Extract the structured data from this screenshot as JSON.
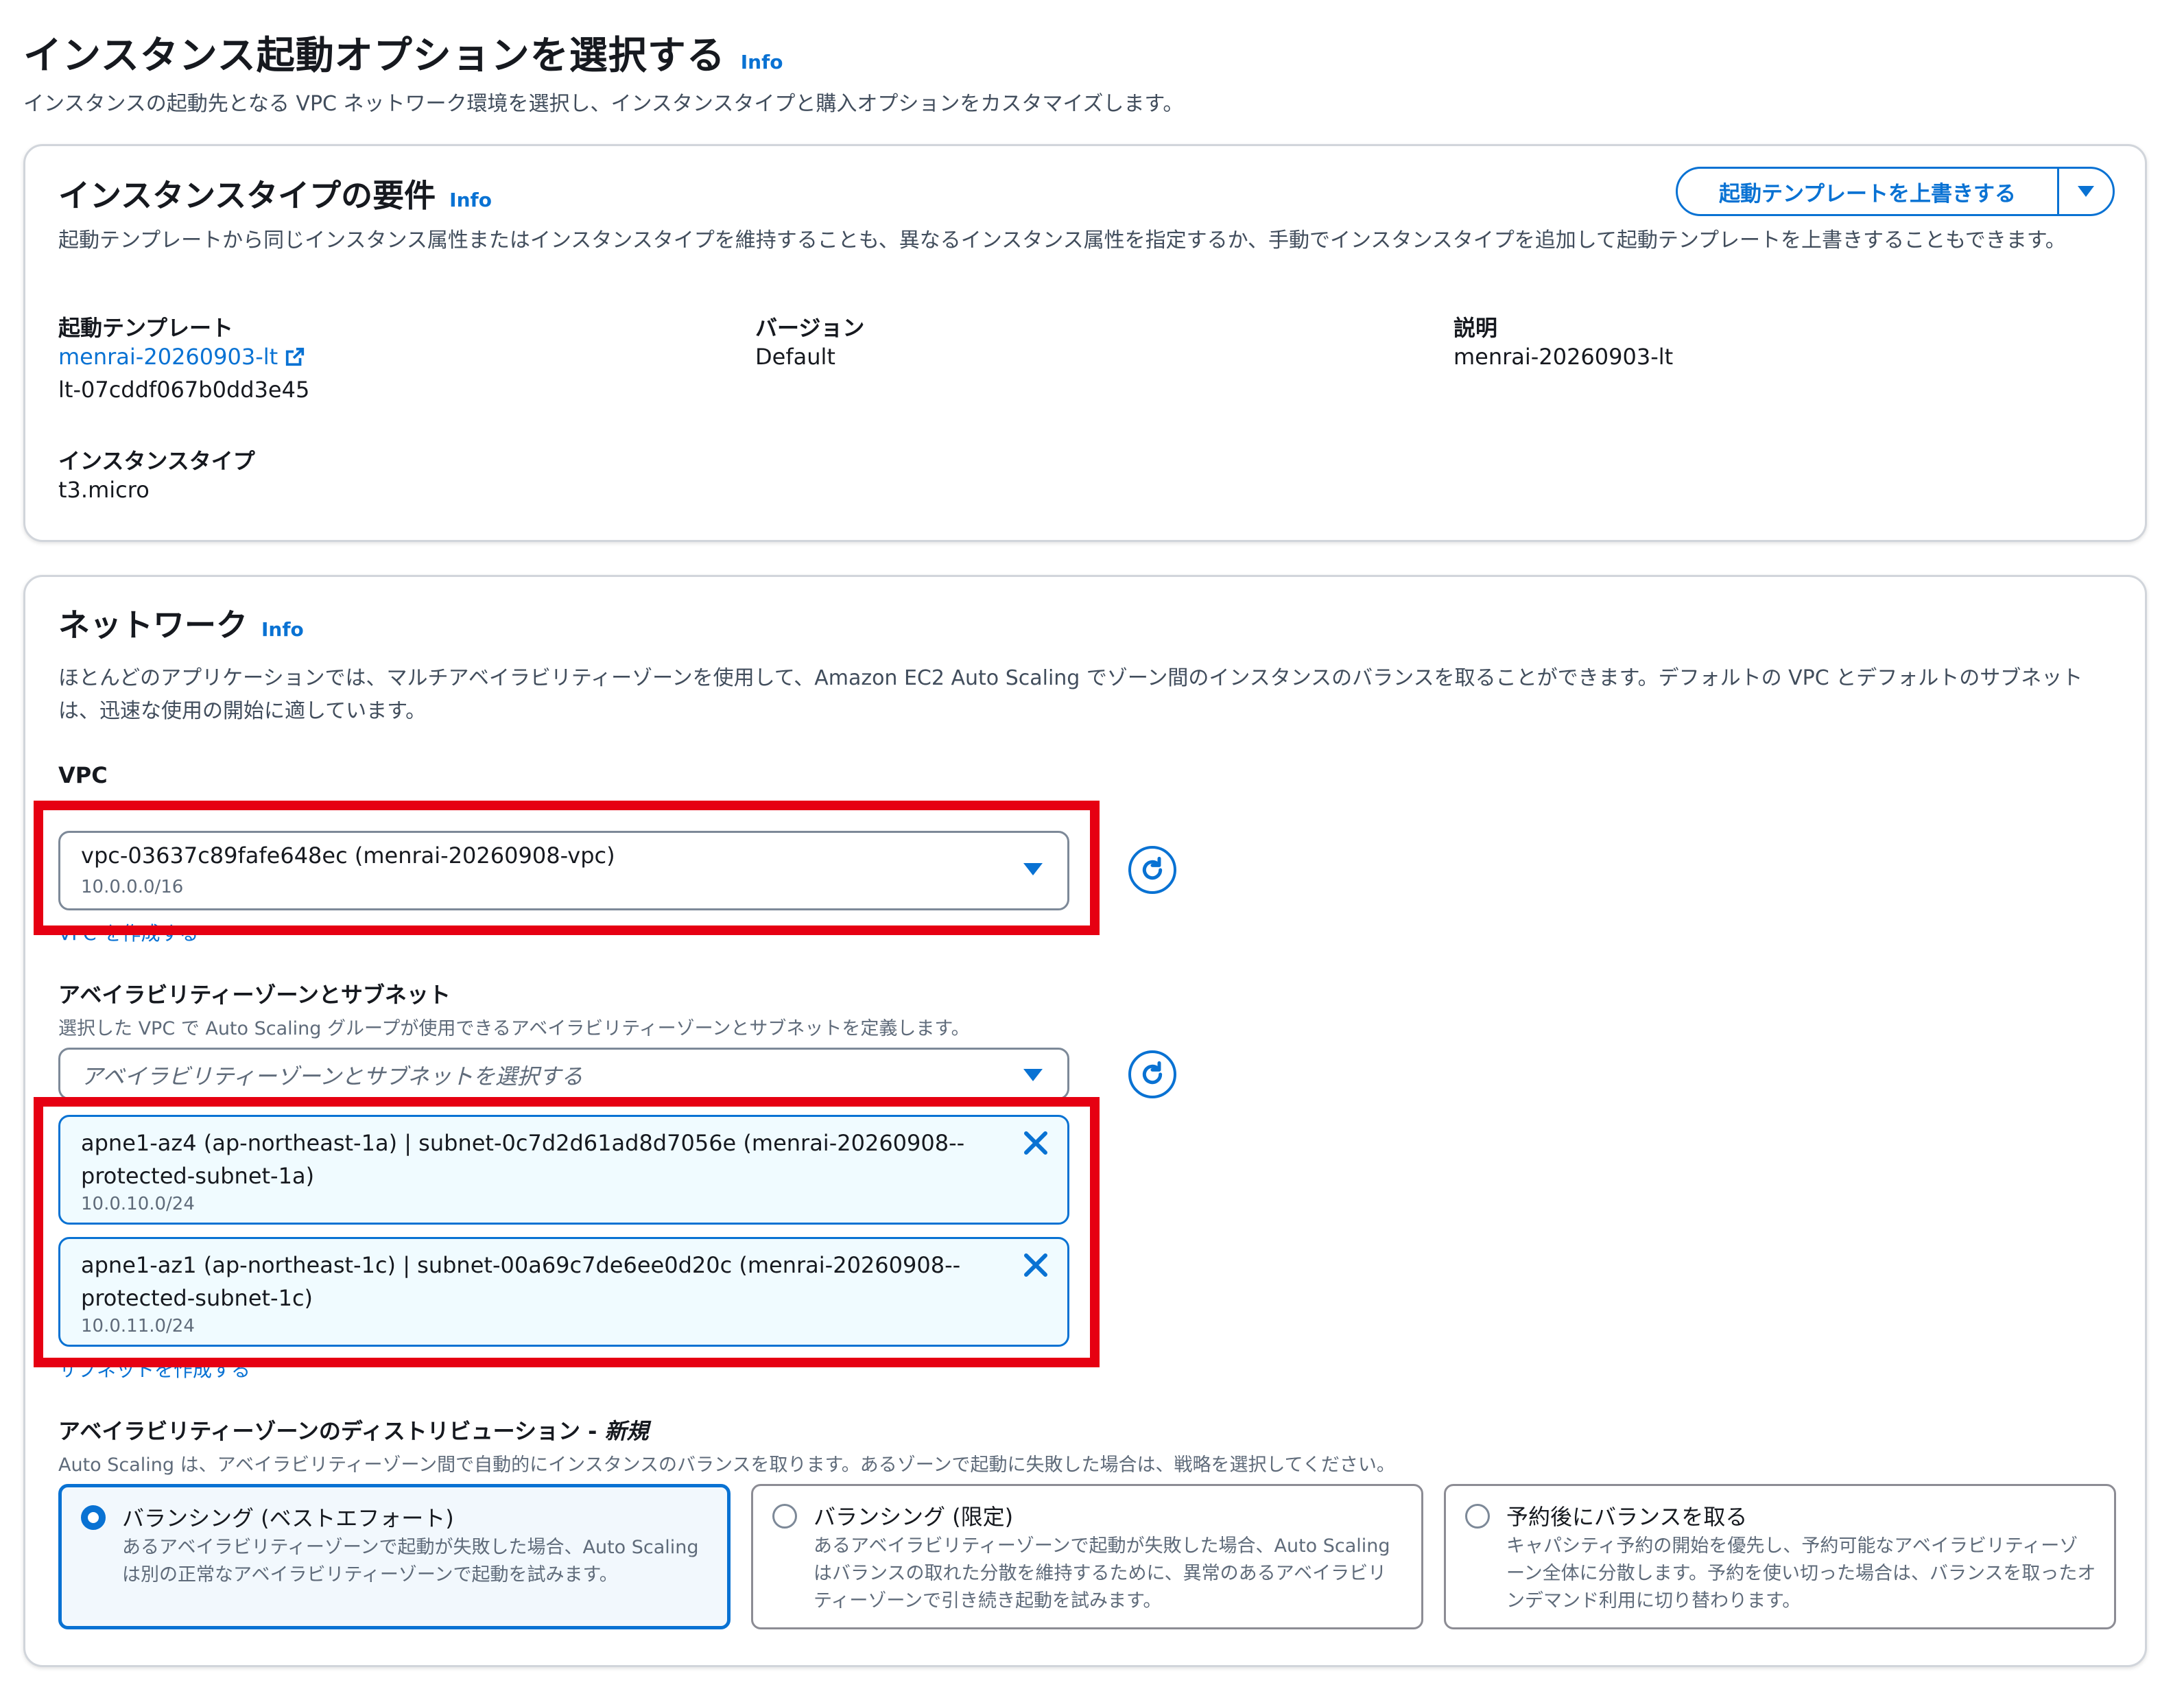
{
  "page": {
    "title": "インスタンス起動オプションを選択する",
    "info": "Info",
    "description": "インスタンスの起動先となる VPC ネットワーク環境を選択し、インスタンスタイプと購入オプションをカスタマイズします。"
  },
  "instance_requirements": {
    "title": "インスタンスタイプの要件",
    "info": "Info",
    "override_button": "起動テンプレートを上書きする",
    "description": "起動テンプレートから同じインスタンス属性またはインスタンスタイプを維持することも、異なるインスタンス属性を指定するか、手動でインスタンスタイプを追加して起動テンプレートを上書きすることもできます。",
    "launch_template_label": "起動テンプレート",
    "launch_template_name": "menrai-20260903-lt",
    "launch_template_id": "lt-07cddf067b0dd3e45",
    "version_label": "バージョン",
    "version_value": "Default",
    "description_label": "説明",
    "description_value": "menrai-20260903-lt",
    "instance_type_label": "インスタンスタイプ",
    "instance_type_value": "t3.micro"
  },
  "network": {
    "title": "ネットワーク",
    "info": "Info",
    "description": "ほとんどのアプリケーションでは、マルチアベイラビリティーゾーンを使用して、Amazon EC2 Auto Scaling でゾーン間のインスタンスのバランスを取ることができます。デフォルトの VPC とデフォルトのサブネットは、迅速な使用の開始に適しています。",
    "vpc_label": "VPC",
    "vpc_selected": "vpc-03637c89fafe648ec (menrai-20260908-vpc)",
    "vpc_cidr": "10.0.0.0/16",
    "create_vpc_link": "VPC を作成する",
    "az_label": "アベイラビリティーゾーンとサブネット",
    "az_hint": "選択した VPC で Auto Scaling グループが使用できるアベイラビリティーゾーンとサブネットを定義します。",
    "az_placeholder": "アベイラビリティーゾーンとサブネットを選択する",
    "subnets": [
      {
        "label": "apne1-az4 (ap-northeast-1a) | subnet-0c7d2d61ad8d7056e (menrai-20260908--protected-subnet-1a)",
        "cidr": "10.0.10.0/24"
      },
      {
        "label": "apne1-az1 (ap-northeast-1c) | subnet-00a69c7de6ee0d20c (menrai-20260908--protected-subnet-1c)",
        "cidr": "10.0.11.0/24"
      }
    ],
    "create_subnet_link": "サブネットを作成する",
    "distribution_label": "アベイラビリティーゾーンのディストリビューション - ",
    "distribution_new": "新規",
    "distribution_hint": "Auto Scaling は、アベイラビリティーゾーン間で自動的にインスタンスのバランスを取ります。あるゾーンで起動に失敗した場合は、戦略を選択してください。",
    "options": [
      {
        "title": "バランシング (ベストエフォート)",
        "desc": "あるアベイラビリティーゾーンで起動が失敗した場合、Auto Scaling は別の正常なアベイラビリティーゾーンで起動を試みます。"
      },
      {
        "title": "バランシング (限定)",
        "desc": "あるアベイラビリティーゾーンで起動が失敗した場合、Auto Scaling はバランスの取れた分散を維持するために、異常のあるアベイラビリティーゾーンで引き続き起動を試みます。"
      },
      {
        "title": "予約後にバランスを取る",
        "desc": "キャパシティ予約の開始を優先し、予約可能なアベイラビリティーゾーン全体に分散します。予約を使い切った場合は、バランスを取ったオンデマンド利用に切り替わります。"
      }
    ],
    "selected_option_index": 0
  },
  "colors": {
    "accent": "#0972d3",
    "highlight": "#e60012",
    "token_bg": "#f0fbff"
  }
}
